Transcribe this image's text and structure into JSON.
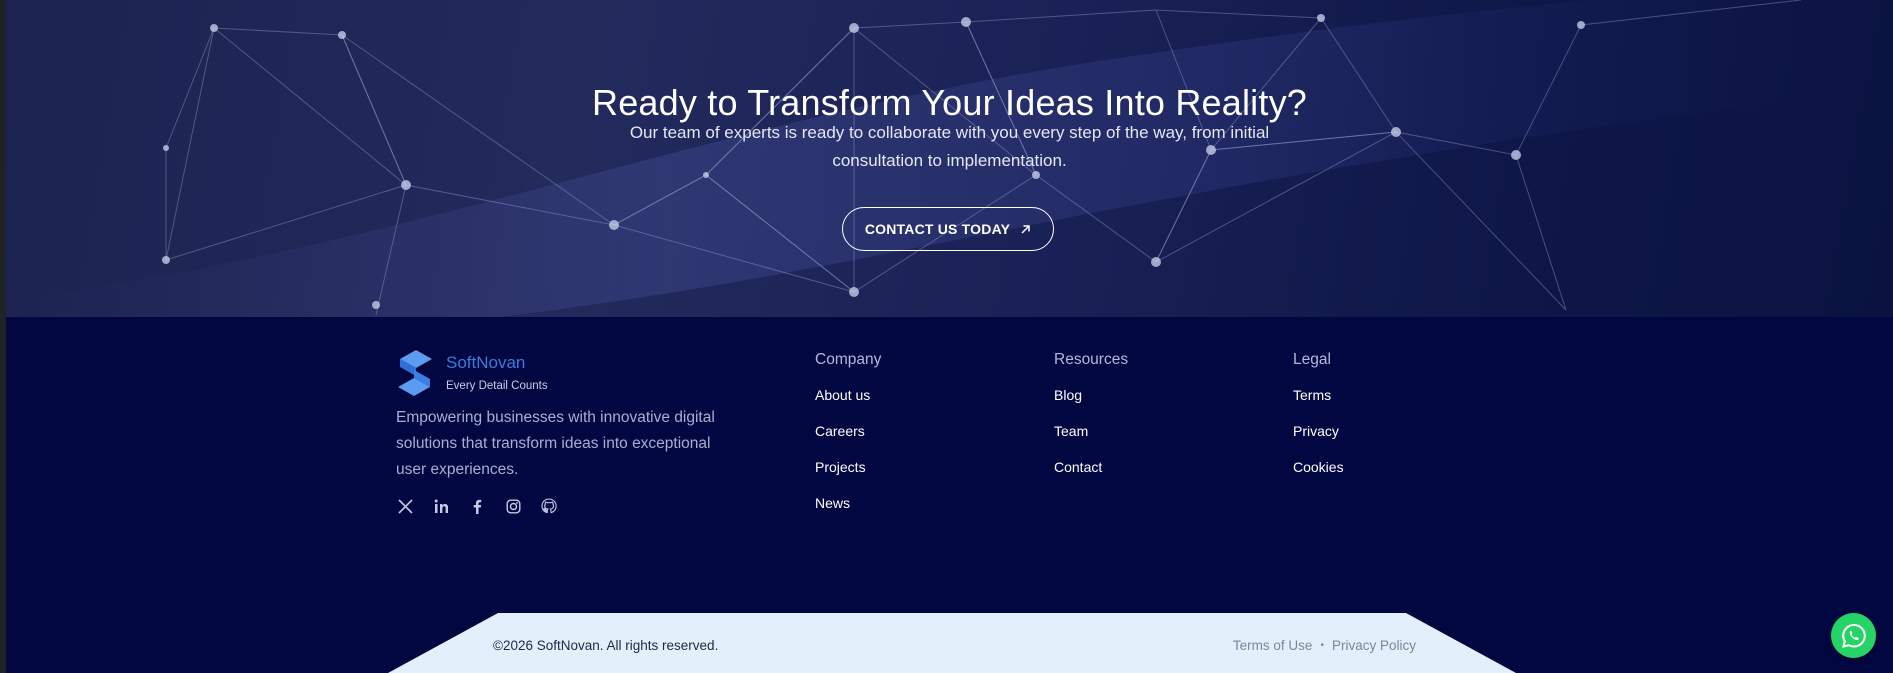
{
  "hero": {
    "title": "Ready to Transform Your Ideas Into Reality?",
    "subtitle": "Our team of experts is ready to collaborate with you every step of the way, from initial consultation to implementation.",
    "cta_label": "CONTACT US TODAY",
    "cta_icon": "arrow-up-right-icon"
  },
  "footer": {
    "brand": {
      "name": "SoftNovan",
      "tagline": "Every Detail Counts",
      "logo_icon": "softnovan-logo-icon",
      "description": "Empowering businesses with innovative digital solutions that transform ideas into exceptional user experiences."
    },
    "socials": [
      "x-icon",
      "linkedin-icon",
      "facebook-icon",
      "instagram-icon",
      "github-icon"
    ],
    "columns": [
      {
        "title": "Company",
        "links": [
          "About us",
          "Careers",
          "Projects",
          "News"
        ]
      },
      {
        "title": "Resources",
        "links": [
          "Blog",
          "Team",
          "Contact"
        ]
      },
      {
        "title": "Legal",
        "links": [
          "Terms",
          "Privacy",
          "Cookies"
        ]
      }
    ],
    "bottom": {
      "copyright": "©2026 SoftNovan. All rights reserved.",
      "terms_of_use": "Terms of Use",
      "separator": "•",
      "privacy_policy": "Privacy Policy"
    }
  },
  "whatsapp_icon": "whatsapp-icon",
  "colors": {
    "footer_bg": "#020742",
    "brand_blue": "#3d7bdc",
    "bottom_bar_bg": "#e3f0fc",
    "whatsapp_green": "#25d366"
  }
}
